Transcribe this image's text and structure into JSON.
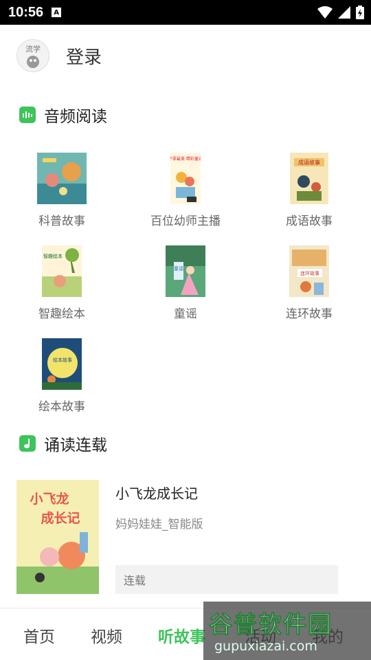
{
  "status_bar": {
    "time": "10:56",
    "notif_letter": "A"
  },
  "login": {
    "avatar_text": "流学",
    "label": "登录"
  },
  "section_audio": {
    "title": "音频阅读"
  },
  "audio_items": [
    {
      "label": "科普故事"
    },
    {
      "label": "百位幼师主播",
      "cover_text": "不拿最美 精彩童说"
    },
    {
      "label": "成语故事",
      "cover_text": "成语故事"
    },
    {
      "label": "智趣绘本",
      "cover_text": "智趣绘本"
    },
    {
      "label": "童谣",
      "cover_text": "童谣"
    },
    {
      "label": "连环故事",
      "cover_text": "连环故事"
    },
    {
      "label": "绘本故事",
      "cover_text": "绘本故事"
    }
  ],
  "section_recite": {
    "title": "诵读连载"
  },
  "book": {
    "cover_text_1": "小飞龙",
    "cover_text_2": "成长记",
    "title": "小飞龙成长记",
    "subtitle": "妈妈娃娃_智能版",
    "tag": "连载"
  },
  "nav": {
    "items": [
      {
        "label": "首页"
      },
      {
        "label": "视频"
      },
      {
        "label": "听故事"
      },
      {
        "label": "活动"
      },
      {
        "label": "我的"
      }
    ],
    "active_index": 2
  },
  "watermark": {
    "main": "谷普软件园",
    "sub": "gupuxiazai.com"
  },
  "colors": {
    "accent": "#3ec45b",
    "status_bar": "#000000"
  }
}
